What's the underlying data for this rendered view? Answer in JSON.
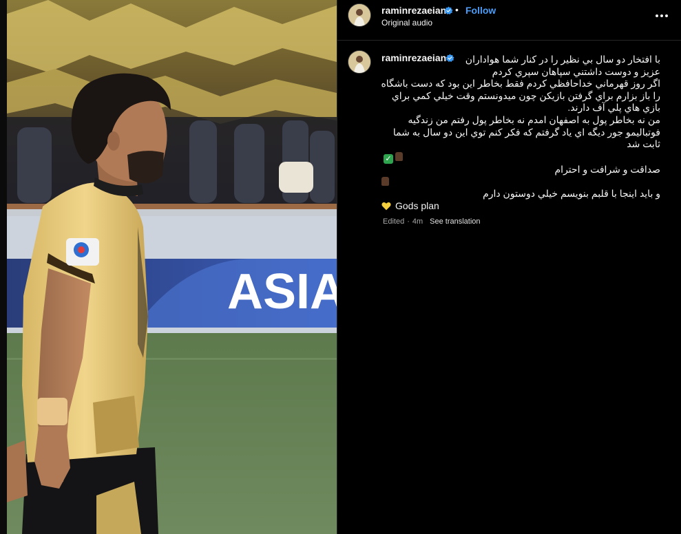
{
  "post": {
    "username": "raminrezaeian",
    "follow_label": "Follow",
    "separator": "•",
    "audio_label": "Original audio",
    "more_icon": "more-options-icon"
  },
  "caption": {
    "username": "raminrezaeian",
    "lines": [
      "با افتخار دو سال بي نظير را در كنار شما هواداران",
      "عزيز و دوست داشتني سپاهان سپري كردم",
      "اگر روز قهرماني خداحافظي كردم فقط بخاطر اين بود كه دست باشگاه",
      "را باز بزارم براي گرفتن بازيكن چون ميدونستم وقت خيلي كمي براي",
      "بازي هاي پلي آف دارند.",
      "من نه بخاطر پول به اصفهان امدم نه بخاطر پول رفتم من زندگيه",
      "فوتباليمو جور ديگه اي ياد گرفتم كه فكر كنم توي اين دو سال به شما",
      "ثابت شد",
      "صداقت و شرافت و احترام",
      "و بايد اينجا با قلبم بنويسم خيلي دوستون دارم",
      "Gods plan"
    ],
    "check_glyph": "✓",
    "edited_label": "Edited",
    "separator": "·",
    "time_label": "4m",
    "translate_label": "See translation"
  },
  "colors": {
    "background": "#000000",
    "link": "#4a9df8",
    "verified": "#3897f0",
    "muted": "#a8a8a8",
    "jersey": "#e6c77a",
    "check": "#2ea44f",
    "heart": "#f4d03f"
  }
}
